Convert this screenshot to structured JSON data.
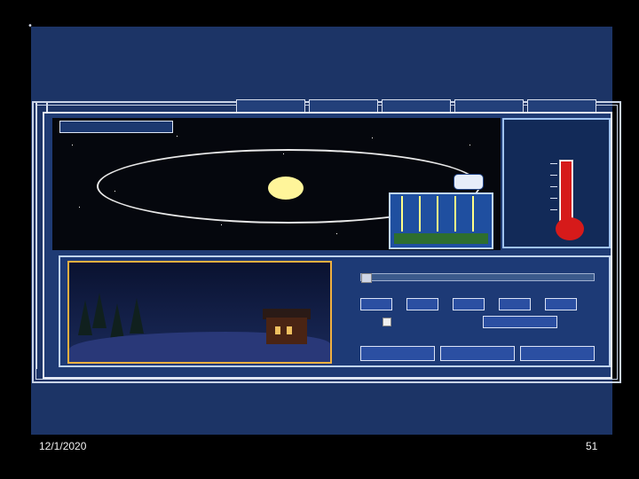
{
  "slide": {
    "date": "12/1/2020",
    "page_number": "51"
  },
  "app": {
    "tabs": [
      "",
      "",
      "",
      "",
      ""
    ],
    "season_label": "",
    "winter_text": "",
    "sunlight_label": "",
    "temp_title": "",
    "temp_scale": [
      "",
      "",
      "",
      "",
      ""
    ],
    "scene_left_label": "",
    "scene_right_label": "",
    "inclination_label": "",
    "months": [
      "",
      "",
      "",
      "",
      ""
    ],
    "checkbox_label": "",
    "mid_button": "",
    "question_text": "",
    "answer_buttons": [
      "",
      "",
      ""
    ]
  },
  "colors": {
    "slide_bg": "#1c3466",
    "panel": "#1f3b74",
    "thermometer": "#d61a1a",
    "sun": "#fff59a",
    "scene_border": "#f0b040"
  },
  "icons": {
    "bullet": "bullet-dot-icon",
    "sun": "sun-icon",
    "earth": "earth-icon",
    "thermometer": "thermometer-icon",
    "cabin": "cabin-icon"
  }
}
